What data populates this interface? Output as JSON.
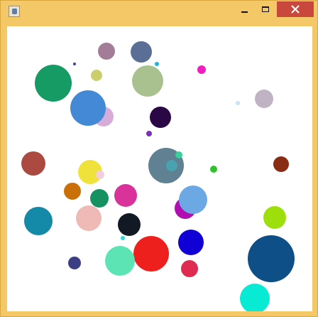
{
  "window": {
    "title": "",
    "title_controls": {
      "minimize": "minimize",
      "maximize": "maximize",
      "close": "close"
    },
    "close_color": "#c9483e"
  },
  "circles": [
    {
      "color": "#a27c98"
    },
    {
      "color": "#5b6f96"
    },
    {
      "color": "#3f3f9f"
    },
    {
      "color": "#1db5d6"
    },
    {
      "color": "#159b63"
    },
    {
      "color": "#cbcf6b"
    },
    {
      "color": "#a9c18e"
    },
    {
      "color": "#f01dc0"
    },
    {
      "color": "#d7acd8"
    },
    {
      "color": "#4389d6"
    },
    {
      "color": "#2a0845"
    },
    {
      "color": "#c8e4f6"
    },
    {
      "color": "#c0b3c3"
    },
    {
      "color": "#7a32b8"
    },
    {
      "color": "#ab4a40"
    },
    {
      "color": "#efe33b"
    },
    {
      "color": "#f5cedd"
    },
    {
      "color": "#5f8192"
    },
    {
      "color": "#37cf9a"
    },
    {
      "color": "#2fc22b"
    },
    {
      "color": "#8a2b13"
    },
    {
      "color": "#c97009"
    },
    {
      "color": "#169162"
    },
    {
      "color": "#d9329b"
    },
    {
      "color": "#b10eb1"
    },
    {
      "color": "#6ca8e3"
    },
    {
      "color": "#1489a8"
    },
    {
      "color": "#efb9b5"
    },
    {
      "color": "#111a24"
    },
    {
      "color": "#9ddf0c"
    },
    {
      "color": "#2ad9d6"
    },
    {
      "color": "#ee201d"
    },
    {
      "color": "#1100d6"
    },
    {
      "color": "#3b3e83"
    },
    {
      "color": "#5de4b4"
    },
    {
      "color": "#df2b51"
    },
    {
      "color": "#0d4f86"
    },
    {
      "color": "#08ead3"
    },
    {
      "color": "#48a2b0"
    },
    {
      "color": "#c8e4f6"
    }
  ]
}
